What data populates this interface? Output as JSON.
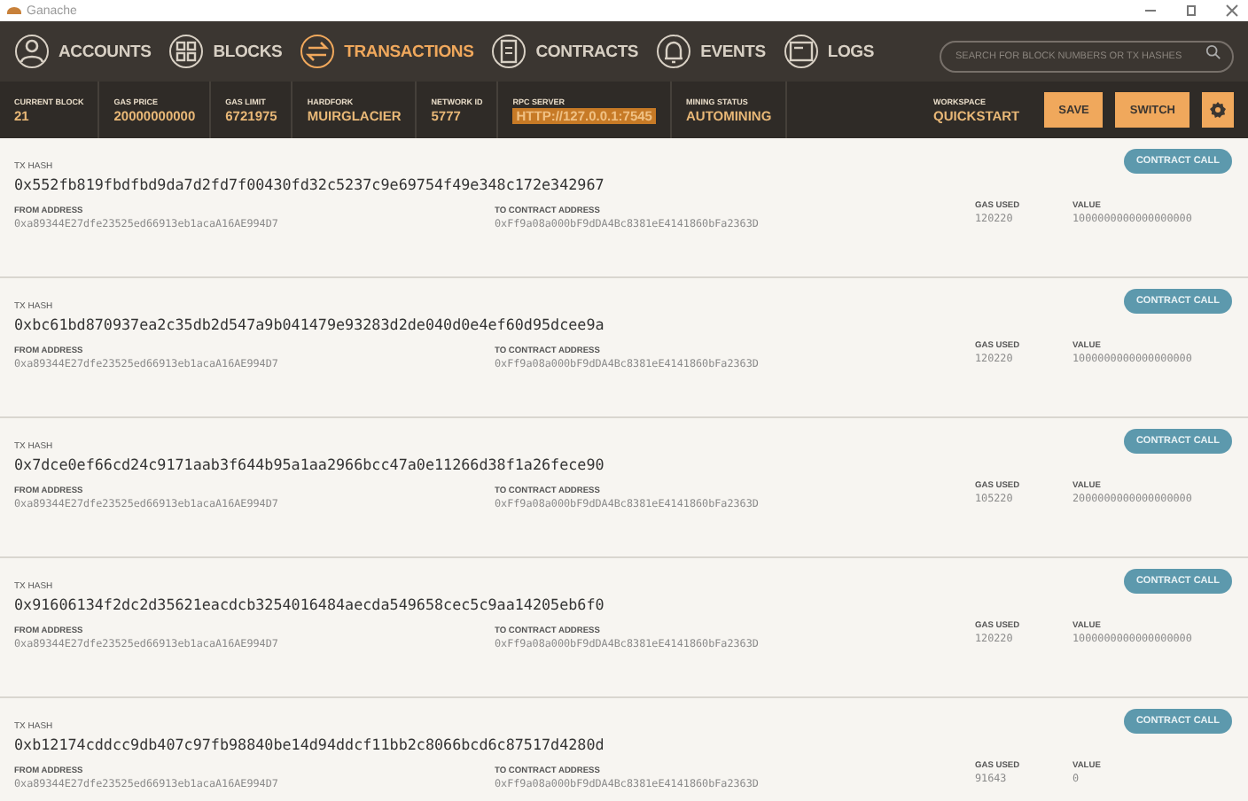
{
  "window": {
    "title": "Ganache"
  },
  "nav": {
    "items": [
      {
        "label": "ACCOUNTS",
        "selected": false
      },
      {
        "label": "BLOCKS",
        "selected": false
      },
      {
        "label": "TRANSACTIONS",
        "selected": true
      },
      {
        "label": "CONTRACTS",
        "selected": false
      },
      {
        "label": "EVENTS",
        "selected": false
      },
      {
        "label": "LOGS",
        "selected": false
      }
    ],
    "search": {
      "placeholder": "SEARCH FOR BLOCK NUMBERS OR TX HASHES"
    }
  },
  "stats": {
    "items": [
      {
        "label": "CURRENT BLOCK",
        "value": "21",
        "highlighted": false
      },
      {
        "label": "GAS PRICE",
        "value": "20000000000",
        "highlighted": false
      },
      {
        "label": "GAS LIMIT",
        "value": "6721975",
        "highlighted": false
      },
      {
        "label": "HARDFORK",
        "value": "MUIRGLACIER",
        "highlighted": false
      },
      {
        "label": "NETWORK ID",
        "value": "5777",
        "highlighted": false
      },
      {
        "label": "RPC SERVER",
        "value": "HTTP://127.0.0.1:7545",
        "highlighted": true
      },
      {
        "label": "MINING STATUS",
        "value": "AUTOMINING",
        "highlighted": false
      }
    ],
    "workspace": {
      "label": "WORKSPACE",
      "value": "QUICKSTART"
    },
    "buttons": [
      "SAVE",
      "SWITCH"
    ]
  },
  "transactions": [
    {
      "hash_label": "TX HASH",
      "hash": "0x552fb819fbdfbd9da7d2fd7f00430fd32c5237c9e69754f49e348c172e342967",
      "type": "CONTRACT CALL",
      "from_label": "FROM ADDRESS",
      "from": "0xa89344E27dfe23525ed66913eb1acaA16AE994D7",
      "to_label": "TO CONTRACT ADDRESS",
      "to": "0xFf9a08a000bF9dDA4Bc8381eE4141860bFa2363D",
      "gas_label": "GAS USED",
      "gas": "120220",
      "value_label": "VALUE",
      "value": "1000000000000000000"
    },
    {
      "hash_label": "TX HASH",
      "hash": "0xbc61bd870937ea2c35db2d547a9b041479e93283d2de040d0e4ef60d95dcee9a",
      "type": "CONTRACT CALL",
      "from_label": "FROM ADDRESS",
      "from": "0xa89344E27dfe23525ed66913eb1acaA16AE994D7",
      "to_label": "TO CONTRACT ADDRESS",
      "to": "0xFf9a08a000bF9dDA4Bc8381eE4141860bFa2363D",
      "gas_label": "GAS USED",
      "gas": "120220",
      "value_label": "VALUE",
      "value": "1000000000000000000"
    },
    {
      "hash_label": "TX HASH",
      "hash": "0x7dce0ef66cd24c9171aab3f644b95a1aa2966bcc47a0e11266d38f1a26fece90",
      "type": "CONTRACT CALL",
      "from_label": "FROM ADDRESS",
      "from": "0xa89344E27dfe23525ed66913eb1acaA16AE994D7",
      "to_label": "TO CONTRACT ADDRESS",
      "to": "0xFf9a08a000bF9dDA4Bc8381eE4141860bFa2363D",
      "gas_label": "GAS USED",
      "gas": "105220",
      "value_label": "VALUE",
      "value": "2000000000000000000"
    },
    {
      "hash_label": "TX HASH",
      "hash": "0x91606134f2dc2d35621eacdcb3254016484aecda549658cec5c9aa14205eb6f0",
      "type": "CONTRACT CALL",
      "from_label": "FROM ADDRESS",
      "from": "0xa89344E27dfe23525ed66913eb1acaA16AE994D7",
      "to_label": "TO CONTRACT ADDRESS",
      "to": "0xFf9a08a000bF9dDA4Bc8381eE4141860bFa2363D",
      "gas_label": "GAS USED",
      "gas": "120220",
      "value_label": "VALUE",
      "value": "1000000000000000000"
    },
    {
      "hash_label": "TX HASH",
      "hash": "0xb12174cddcc9db407c97fb98840be14d94ddcf11bb2c8066bcd6c87517d4280d",
      "type": "CONTRACT CALL",
      "from_label": "FROM ADDRESS",
      "from": "0xa89344E27dfe23525ed66913eb1acaA16AE994D7",
      "to_label": "TO CONTRACT ADDRESS",
      "to": "0xFf9a08a000bF9dDA4Bc8381eE4141860bFa2363D",
      "gas_label": "GAS USED",
      "gas": "91643",
      "value_label": "VALUE",
      "value": "0"
    }
  ]
}
